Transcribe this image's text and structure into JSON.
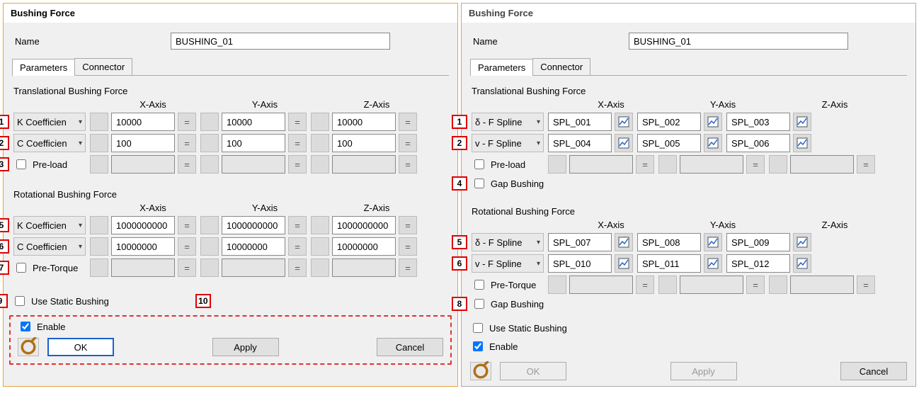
{
  "left": {
    "title": "Bushing Force",
    "name_label": "Name",
    "name_value": "BUSHING_01",
    "tabs": [
      "Parameters",
      "Connector"
    ],
    "trans_title": "Translational Bushing Force",
    "rot_title": "Rotational Bushing Force",
    "axes": [
      "X-Axis",
      "Y-Axis",
      "Z-Axis"
    ],
    "row1_dd": "K Coefficien",
    "row1_vals": [
      "10000",
      "10000",
      "10000"
    ],
    "row2_dd": "C Coefficien",
    "row2_vals": [
      "100",
      "100",
      "100"
    ],
    "preload_label": "Pre-load",
    "row5_dd": "K Coefficien",
    "row5_vals": [
      "1000000000",
      "1000000000",
      "1000000000"
    ],
    "row6_dd": "C Coefficien",
    "row6_vals": [
      "10000000",
      "10000000",
      "10000000"
    ],
    "pretorque_label": "Pre-Torque",
    "static_label": "Use Static Bushing",
    "enable_label": "Enable",
    "ok": "OK",
    "apply": "Apply",
    "cancel": "Cancel",
    "callouts": {
      "r1": "1",
      "r2": "2",
      "r3": "3",
      "r5": "5",
      "r6": "6",
      "r7": "7",
      "r9": "9",
      "r10": "10"
    }
  },
  "right": {
    "title": "Bushing Force",
    "name_label": "Name",
    "name_value": "BUSHING_01",
    "tabs": [
      "Parameters",
      "Connector"
    ],
    "trans_title": "Translational Bushing Force",
    "rot_title": "Rotational Bushing Force",
    "axes": [
      "X-Axis",
      "Y-Axis",
      "Z-Axis"
    ],
    "row1_dd": "δ - F Spline",
    "row1_vals": [
      "SPL_001",
      "SPL_002",
      "SPL_003"
    ],
    "row2_dd": "v - F Spline",
    "row2_vals": [
      "SPL_004",
      "SPL_005",
      "SPL_006"
    ],
    "preload_label": "Pre-load",
    "gap1_label": "Gap Bushing",
    "row5_dd": "δ - F Spline",
    "row5_vals": [
      "SPL_007",
      "SPL_008",
      "SPL_009"
    ],
    "row6_dd": "v - F Spline",
    "row6_vals": [
      "SPL_010",
      "SPL_011",
      "SPL_012"
    ],
    "pretorque_label": "Pre-Torque",
    "gap2_label": "Gap Bushing",
    "static_label": "Use Static Bushing",
    "enable_label": "Enable",
    "ok": "OK",
    "apply": "Apply",
    "cancel": "Cancel",
    "callouts": {
      "r1": "1",
      "r2": "2",
      "r4": "4",
      "r5": "5",
      "r6": "6",
      "r8": "8"
    }
  }
}
